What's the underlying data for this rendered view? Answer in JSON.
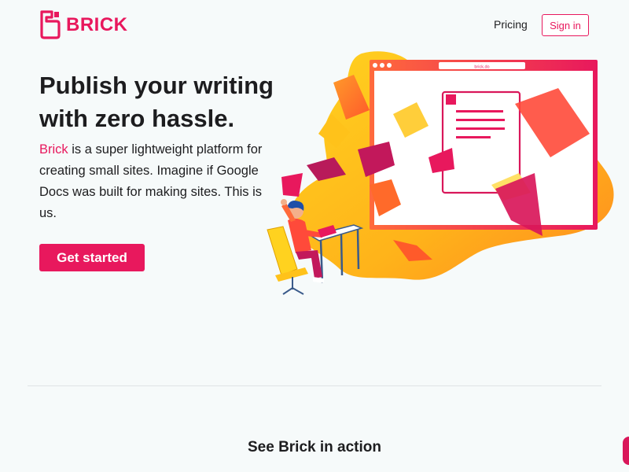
{
  "brand": {
    "name": "BRICK",
    "color": "#e8185d"
  },
  "nav": {
    "pricing_label": "Pricing",
    "signin_label": "Sign in"
  },
  "hero": {
    "title": "Publish your writing with zero hassle.",
    "body_brand": "Brick",
    "body_rest": " is a super lightweight platform for creating small sites. Imagine if Google Docs was built for making sites. This is us.",
    "cta_label": "Get started"
  },
  "illustration": {
    "browser_url": "brick.do",
    "icon": "person-writing-illustration"
  },
  "section": {
    "title": "See Brick in action"
  },
  "colors": {
    "accent": "#e8185d",
    "background": "#f6fafa",
    "blob_yellow": "#ffc21a",
    "blob_orange": "#ff8a1f"
  }
}
